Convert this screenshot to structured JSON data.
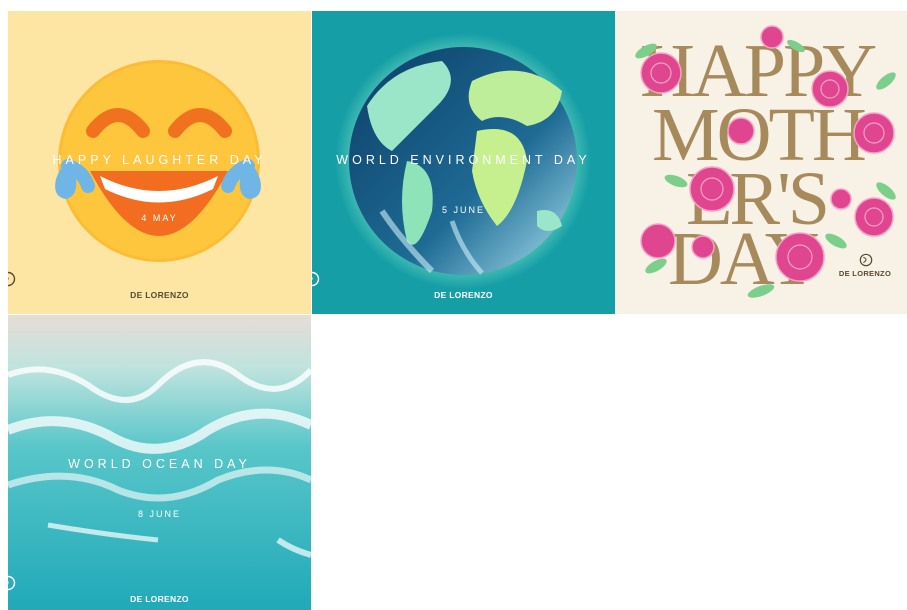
{
  "tiles": [
    {
      "headline": "HAPPY LAUGHTER DAY",
      "date": "4 MAY",
      "brand": "DE LORENZO",
      "image": "laughing-emoji"
    },
    {
      "headline": "WORLD ENVIRONMENT DAY",
      "date": "5 JUNE",
      "brand": "DE LORENZO",
      "image": "earth-globe"
    },
    {
      "headline_lines": [
        "HAPPY",
        "MOTH",
        "ER'S",
        "DAY"
      ],
      "brand": "DE LORENZO",
      "image": "pink-roses"
    },
    {
      "headline": "WORLD OCEAN DAY",
      "date": "8 JUNE",
      "brand": "DE LORENZO",
      "image": "aerial-ocean-waves"
    }
  ],
  "colors": {
    "brand_dark": "#5a4a32",
    "brand_light": "#ffffff",
    "gold": "#a68a5c",
    "rose": "#e0468f"
  }
}
